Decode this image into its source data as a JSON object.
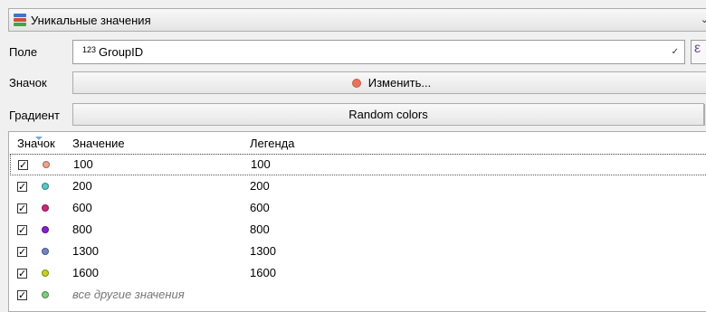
{
  "renderer": {
    "label": "Уникальные значения",
    "icon": "categorized-renderer-icon"
  },
  "field": {
    "label": "Поле",
    "type_badge": "123",
    "value": "GroupID",
    "expression_icon": "ε"
  },
  "symbol": {
    "label": "Значок",
    "button_label": "Изменить...",
    "color": "#e8735c"
  },
  "gradient": {
    "label": "Градиент",
    "value": "Random colors"
  },
  "table": {
    "columns": [
      "Значок",
      "Значение",
      "Легенда"
    ],
    "rows": [
      {
        "checked": true,
        "color": "#f0a48a",
        "value": "100",
        "legend": "100"
      },
      {
        "checked": true,
        "color": "#5ac8c0",
        "value": "200",
        "legend": "200"
      },
      {
        "checked": true,
        "color": "#d0257a",
        "value": "600",
        "legend": "600"
      },
      {
        "checked": true,
        "color": "#8a1ed0",
        "value": "800",
        "legend": "800"
      },
      {
        "checked": true,
        "color": "#6f86c8",
        "value": "1300",
        "legend": "1300"
      },
      {
        "checked": true,
        "color": "#c8d21a",
        "value": "1600",
        "legend": "1600"
      },
      {
        "checked": true,
        "color": "#7ccf7a",
        "value": "все другие значения",
        "legend": ""
      }
    ]
  }
}
